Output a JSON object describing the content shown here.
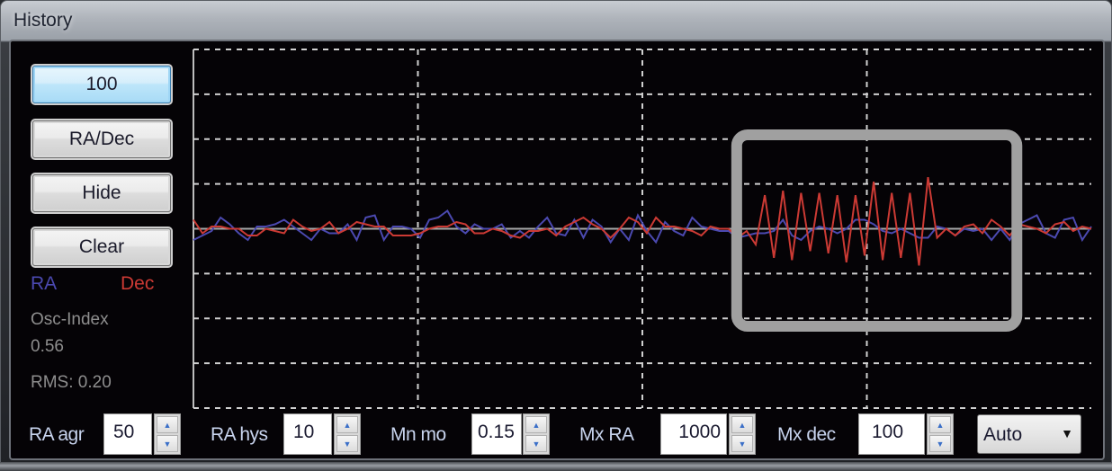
{
  "window": {
    "title": "History"
  },
  "left_panel": {
    "buttons": [
      {
        "label": "100",
        "active": true
      },
      {
        "label": "RA/Dec",
        "active": false
      },
      {
        "label": "Hide",
        "active": false
      },
      {
        "label": "Clear",
        "active": false
      }
    ],
    "legend": {
      "ra_label": "RA",
      "dec_label": "Dec",
      "ra_color": "#4b49b0",
      "dec_color": "#cc3a34"
    },
    "osc_index_label": "Osc-Index",
    "osc_index_value": "0.56",
    "rms_text": "RMS: 0.20"
  },
  "controls": {
    "ra_agr": {
      "label": "RA agr",
      "value": "50"
    },
    "ra_hys": {
      "label": "RA hys",
      "value": "10"
    },
    "mn_mo": {
      "label": "Mn mo",
      "value": "0.15"
    },
    "mx_ra": {
      "label": "Mx RA",
      "value": "1000"
    },
    "mx_dec": {
      "label": "Mx dec",
      "value": "100"
    },
    "scale_dropdown": {
      "selected": "Auto"
    }
  },
  "chart_data": {
    "type": "line",
    "title": "",
    "xlabel": "",
    "ylabel": "",
    "xlim": [
      0,
      99
    ],
    "ylim": [
      -4,
      4
    ],
    "grid": true,
    "x_gridlines": 4,
    "y_gridlines": 8,
    "highlight_region": {
      "x_start": 60,
      "x_end": 90,
      "color": "#a0a0a0",
      "note": "oscillating Dec"
    },
    "series": [
      {
        "name": "RA",
        "color": "#4b49b0",
        "values": [
          -0.25,
          -0.15,
          -0.05,
          0.25,
          0.1,
          -0.1,
          -0.25,
          0.05,
          0.05,
          0.1,
          0.2,
          0.05,
          -0.1,
          -0.25,
          0.0,
          -0.1,
          -0.1,
          0.1,
          -0.25,
          0.25,
          0.3,
          -0.25,
          0.05,
          0.05,
          0.0,
          -0.2,
          0.2,
          0.25,
          0.4,
          0.05,
          -0.1,
          0.1,
          0.0,
          0.0,
          0.1,
          -0.2,
          -0.05,
          -0.2,
          0.05,
          0.25,
          -0.1,
          -0.15,
          0.2,
          -0.2,
          0.2,
          0.05,
          -0.3,
          0.0,
          -0.25,
          0.3,
          -0.05,
          -0.3,
          0.15,
          -0.05,
          -0.15,
          0.25,
          0.05,
          0.0,
          -0.05,
          -0.05,
          -0.2,
          -0.15,
          -0.1,
          -0.1,
          -0.05,
          0.2,
          -0.15,
          -0.25,
          -0.05,
          0.05,
          0.0,
          -0.1,
          0.0,
          0.2,
          0.2,
          0.1,
          -0.05,
          -0.1,
          0.0,
          -0.1,
          -0.2,
          -0.2,
          0.05,
          0.0,
          -0.15,
          0.0,
          -0.05,
          0.0,
          -0.25,
          0.0,
          -0.25,
          0.1,
          0.2,
          0.3,
          -0.1,
          -0.2,
          0.2,
          0.25,
          -0.25,
          0.05
        ]
      },
      {
        "name": "Dec",
        "color": "#cc3a34",
        "values": [
          0.2,
          -0.1,
          0.05,
          0.05,
          0.0,
          0.0,
          -0.15,
          -0.15,
          0.0,
          -0.05,
          -0.1,
          0.2,
          0.05,
          -0.05,
          0.0,
          0.15,
          -0.1,
          0.0,
          0.15,
          0.1,
          0.05,
          0.05,
          -0.15,
          -0.15,
          -0.15,
          -0.1,
          0.0,
          0.05,
          0.05,
          0.15,
          0.1,
          -0.1,
          -0.1,
          0.0,
          -0.05,
          -0.15,
          -0.2,
          -0.05,
          -0.05,
          0.0,
          -0.15,
          0.05,
          0.15,
          0.25,
          0.1,
          0.0,
          -0.2,
          0.0,
          0.25,
          0.15,
          -0.1,
          0.25,
          0.05,
          0.05,
          0.0,
          -0.05,
          -0.15,
          0.05,
          0.0,
          0.0,
          -0.2,
          -0.05,
          -0.35,
          0.75,
          -0.65,
          0.85,
          -0.7,
          0.8,
          -0.5,
          0.8,
          -0.55,
          0.75,
          -0.75,
          0.75,
          -0.6,
          1.05,
          -0.7,
          0.8,
          -0.65,
          0.8,
          -0.82,
          1.15,
          -0.2,
          0.0,
          -0.15,
          0.05,
          0.1,
          -0.1,
          0.2,
          0.05,
          -0.15,
          0.1,
          0.05,
          0.0,
          -0.1,
          0.1,
          0.15,
          -0.05,
          0.05,
          0.0
        ]
      }
    ]
  }
}
